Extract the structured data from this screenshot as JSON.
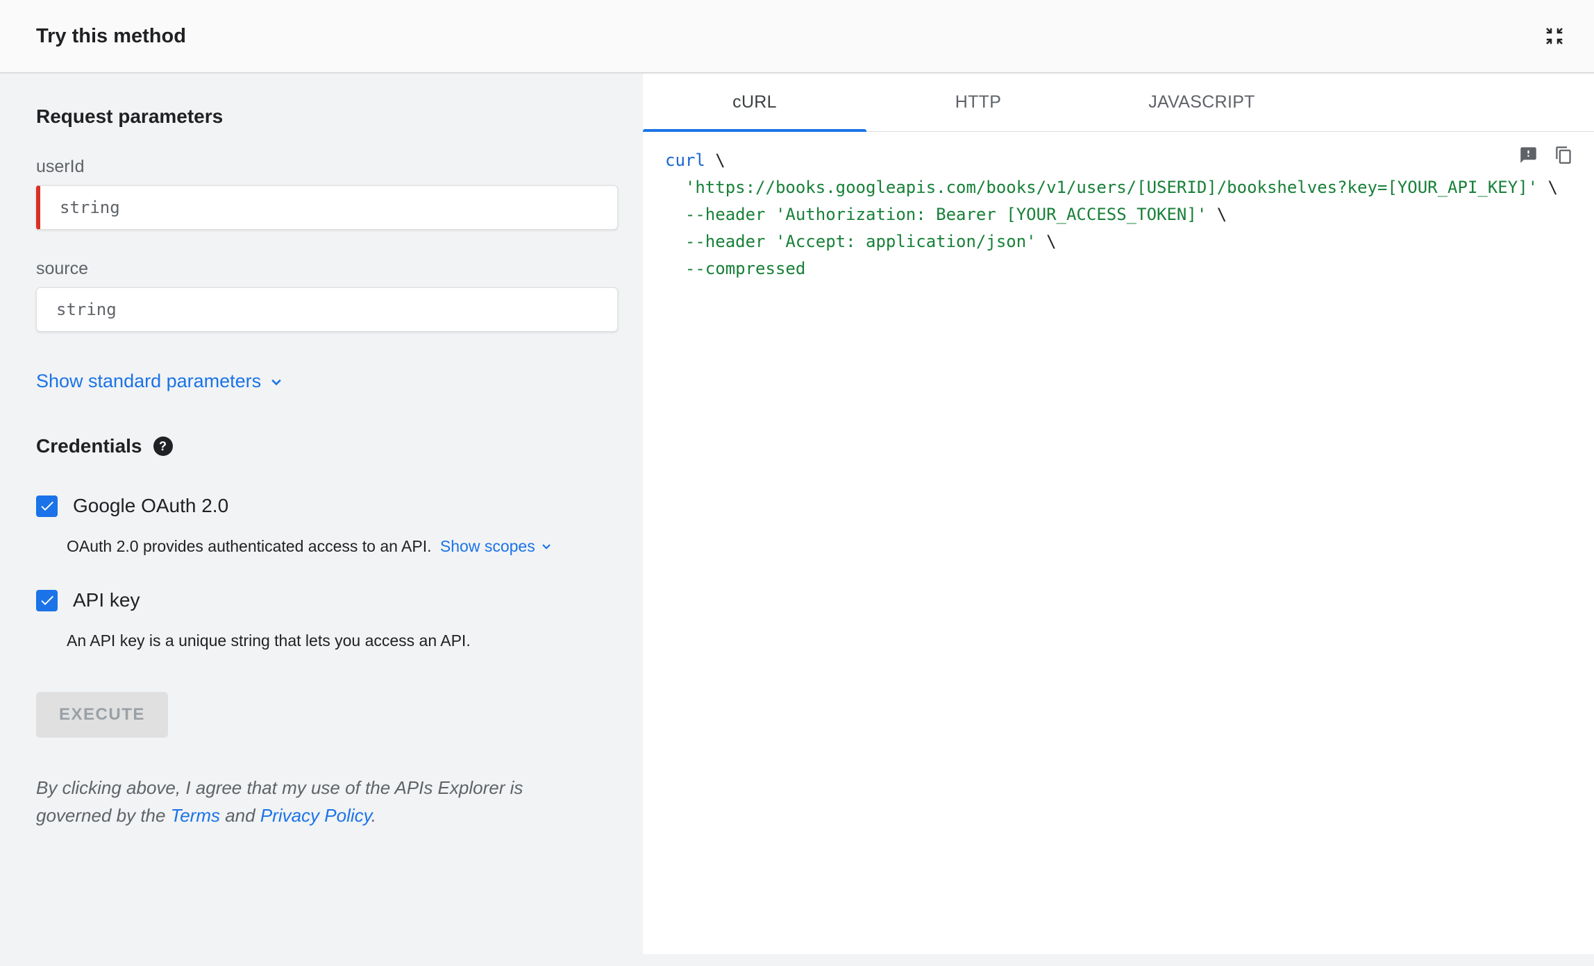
{
  "header": {
    "title": "Try this method"
  },
  "left_panel": {
    "request_heading": "Request parameters",
    "fields": [
      {
        "label": "userId",
        "placeholder": "string",
        "required": true
      },
      {
        "label": "source",
        "placeholder": "string",
        "required": false
      }
    ],
    "show_standard_parameters": "Show standard parameters",
    "credentials_heading": "Credentials",
    "credentials": [
      {
        "label": "Google OAuth 2.0",
        "checked": true,
        "description": "OAuth 2.0 provides authenticated access to an API.",
        "link_label": "Show scopes"
      },
      {
        "label": "API key",
        "checked": true,
        "description": "An API key is a unique string that lets you access an API."
      }
    ],
    "execute_label": "EXECUTE",
    "disclaimer": {
      "text_before": "By clicking above, I agree that my use of the APIs Explorer is governed by the ",
      "terms": "Terms",
      "text_middle": " and ",
      "privacy": "Privacy Policy",
      "text_after": "."
    }
  },
  "tabs": [
    {
      "label": "cURL",
      "active": true
    },
    {
      "label": "HTTP",
      "active": false
    },
    {
      "label": "JAVASCRIPT",
      "active": false
    }
  ],
  "code": {
    "lines": [
      [
        {
          "t": "curl",
          "c": "kw"
        },
        {
          "t": " \\",
          "c": "plain"
        }
      ],
      [
        {
          "t": "  ",
          "c": "plain"
        },
        {
          "t": "'https://books.googleapis.com/books/v1/users/[USERID]/bookshelves?key=[YOUR_API_KEY]'",
          "c": "str"
        },
        {
          "t": " \\",
          "c": "plain"
        }
      ],
      [
        {
          "t": "  ",
          "c": "plain"
        },
        {
          "t": "--header 'Authorization: Bearer [YOUR_ACCESS_TOKEN]'",
          "c": "str"
        },
        {
          "t": " \\",
          "c": "plain"
        }
      ],
      [
        {
          "t": "  ",
          "c": "plain"
        },
        {
          "t": "--header 'Accept: application/json'",
          "c": "str"
        },
        {
          "t": " \\",
          "c": "plain"
        }
      ],
      [
        {
          "t": "  ",
          "c": "plain"
        },
        {
          "t": "--compressed",
          "c": "str"
        }
      ]
    ]
  },
  "icons": {
    "help_glyph": "?"
  },
  "colors": {
    "accent_blue": "#1a73e8",
    "required_red": "#d93025",
    "code_keyword": "#1967d2",
    "code_string": "#188038",
    "left_panel_bg": "#f1f3f4"
  }
}
